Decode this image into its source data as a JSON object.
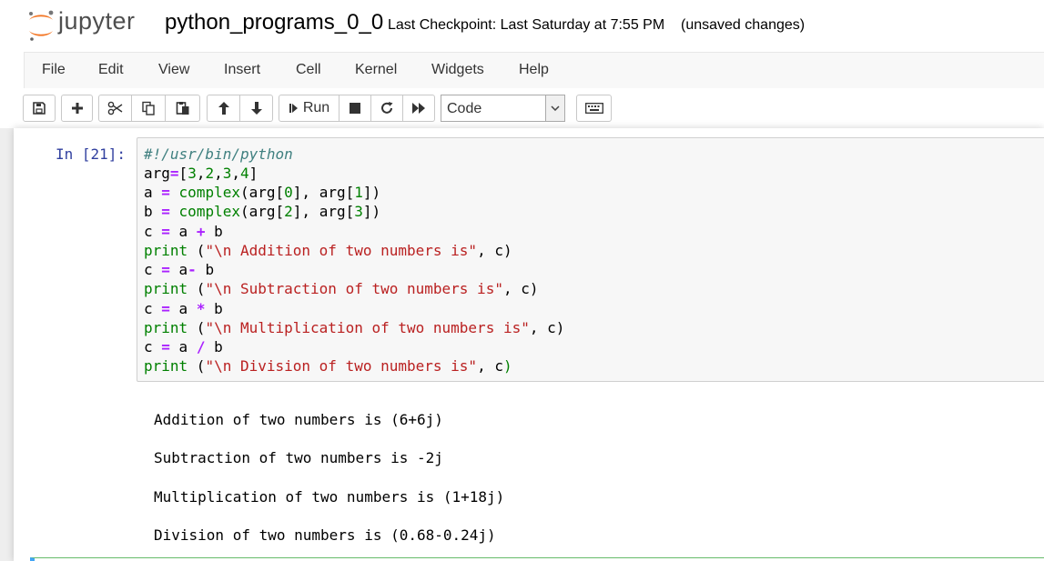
{
  "header": {
    "logo_text": "jupyter",
    "notebook_name": "python_programs_0_0",
    "checkpoint": "Last Checkpoint: Last Saturday at 7:55 PM",
    "autosave": "(unsaved changes)"
  },
  "menu": [
    "File",
    "Edit",
    "View",
    "Insert",
    "Cell",
    "Kernel",
    "Widgets",
    "Help"
  ],
  "toolbar": {
    "run_label": "Run",
    "cell_type": "Code",
    "icons": [
      "save-icon",
      "plus-icon",
      "cut-icon",
      "copy-icon",
      "paste-icon",
      "arrow-up-icon",
      "arrow-down-icon",
      "run-icon",
      "stop-icon",
      "restart-icon",
      "fast-forward-icon",
      "keyboard-icon"
    ]
  },
  "cell": {
    "prompt": "In [21]:",
    "code": {
      "l1": "#!/usr/bin/python",
      "l2_a": "arg",
      "l2_op": "=",
      "l2_b": "[",
      "l2_n1": "3",
      "l2_c1": ",",
      "l2_n2": "2",
      "l2_c2": ",",
      "l2_n3": "3",
      "l2_c3": ",",
      "l2_n4": "4",
      "l2_e": "]",
      "l3_a": "a ",
      "l3_op": "=",
      "l3_sp": " ",
      "l3_fn": "complex",
      "l3_b": "(arg[",
      "l3_n1": "0",
      "l3_c": "], arg[",
      "l3_n2": "1",
      "l3_e": "])",
      "l4_a": "b ",
      "l4_op": "=",
      "l4_sp": " ",
      "l4_fn": "complex",
      "l4_b": "(arg[",
      "l4_n1": "2",
      "l4_c": "], arg[",
      "l4_n2": "3",
      "l4_e": "])",
      "l5_a": "c ",
      "l5_op1": "=",
      "l5_b": " a ",
      "l5_op2": "+",
      "l5_c": " b",
      "l6_fn": "print",
      "l6_a": " (",
      "l6_str": "\"\\n Addition of two numbers is\"",
      "l6_e": ", c)",
      "l7_a": "c ",
      "l7_op1": "=",
      "l7_b": " a",
      "l7_op2": "-",
      "l7_c": " b",
      "l8_fn": "print",
      "l8_a": " (",
      "l8_str": "\"\\n Subtraction of two numbers is\"",
      "l8_e": ", c)",
      "l9_a": "c ",
      "l9_op1": "=",
      "l9_b": " a ",
      "l9_op2": "*",
      "l9_c": " b",
      "l10_fn": "print",
      "l10_a": " (",
      "l10_str": "\"\\n Multiplication of two numbers is\"",
      "l10_e": ", c)",
      "l11_a": "c ",
      "l11_op1": "=",
      "l11_b": " a ",
      "l11_op2": "/",
      "l11_c": " b",
      "l12_fn": "print",
      "l12_a": " (",
      "l12_str": "\"\\n Division of two numbers is\"",
      "l12_e": ", c",
      "l12_close": ")"
    },
    "outputs": [
      "Addition of two numbers is (6+6j)",
      "Subtraction of two numbers is -2j",
      "Multiplication of two numbers is (1+18j)",
      "Division of two numbers is (0.68-0.24j)"
    ]
  }
}
